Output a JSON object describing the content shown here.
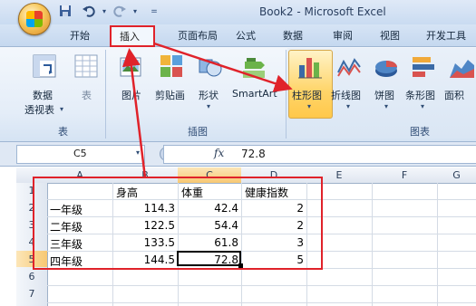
{
  "window": {
    "title": "Book2 - Microsoft Excel"
  },
  "quick_access": [
    {
      "icon": "save-icon"
    },
    {
      "icon": "undo-icon"
    },
    {
      "icon": "redo-icon"
    },
    {
      "icon": "customize-qat-icon"
    }
  ],
  "tabs": [
    "开始",
    "插入",
    "页面布局",
    "公式",
    "数据",
    "审阅",
    "视图",
    "开发工具"
  ],
  "ribbon": {
    "groups": {
      "tables": "表",
      "illustrations": "插图",
      "charts": "图表"
    },
    "buttons": {
      "pivot_line1": "数据",
      "pivot_line2": "透视表",
      "table": "表",
      "picture": "图片",
      "clipart": "剪贴画",
      "shapes": "形状",
      "smartart": "SmartArt",
      "column_chart": "柱形图",
      "line_chart": "折线图",
      "pie_chart": "饼图",
      "bar_chart": "条形图",
      "area_chart": "面积"
    }
  },
  "formula_bar": {
    "name_box": "C5",
    "fx": "fx",
    "value": "72.8"
  },
  "columns": [
    "A",
    "B",
    "C",
    "D",
    "E",
    "F",
    "G"
  ],
  "rows": [
    "1",
    "2",
    "3",
    "4",
    "5",
    "6",
    "7"
  ],
  "sheet": {
    "headers": [
      "身高",
      "体重",
      "健康指数"
    ],
    "data": [
      {
        "grade": "一年级",
        "height": "114.3",
        "weight": "42.4",
        "index": "2"
      },
      {
        "grade": "二年级",
        "height": "122.5",
        "weight": "54.4",
        "index": "2"
      },
      {
        "grade": "三年级",
        "height": "133.5",
        "weight": "61.8",
        "index": "3"
      },
      {
        "grade": "四年级",
        "height": "144.5",
        "weight": "72.8",
        "index": "5"
      }
    ]
  },
  "colors": {
    "annotation_red": "#e0222a",
    "ribbon_blue": "#dbe7f5",
    "highlight": "#ffd56a"
  }
}
